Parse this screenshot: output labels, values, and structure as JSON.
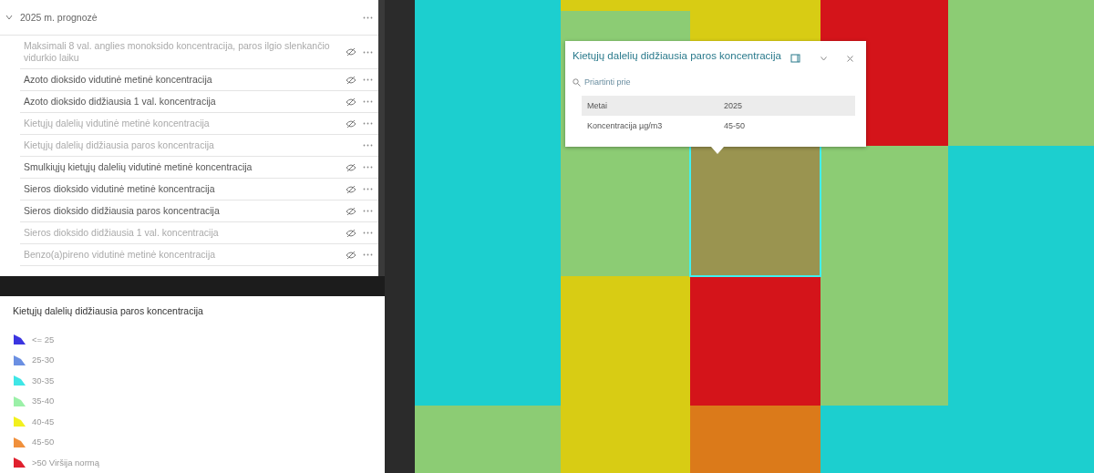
{
  "layer_group": {
    "title": "2025 m. prognozė",
    "expanded": true,
    "layers": [
      {
        "name": "Maksimali 8 val. anglies monoksido koncentracija, paros ilgio slenkančio vidurkio laiku",
        "visible": false,
        "dimmed": true
      },
      {
        "name": "Azoto dioksido vidutinė metinė koncentracija",
        "visible": false,
        "dimmed": false
      },
      {
        "name": "Azoto dioksido didžiausia 1 val. koncentracija",
        "visible": false,
        "dimmed": false
      },
      {
        "name": "Kietųjų dalelių vidutinė metinė koncentracija",
        "visible": false,
        "dimmed": true
      },
      {
        "name": "Kietųjų dalelių didžiausia paros koncentracija",
        "visible": true,
        "dimmed": true
      },
      {
        "name": "Smulkiųjų kietųjų dalelių vidutinė metinė koncentracija",
        "visible": false,
        "dimmed": false
      },
      {
        "name": "Sieros dioksido vidutinė metinė koncentracija",
        "visible": false,
        "dimmed": false
      },
      {
        "name": "Sieros dioksido didžiausia paros koncentracija",
        "visible": false,
        "dimmed": false
      },
      {
        "name": "Sieros dioksido didžiausia 1 val. koncentracija",
        "visible": false,
        "dimmed": true
      },
      {
        "name": "Benzo(a)pireno vidutinė metinė koncentracija",
        "visible": false,
        "dimmed": true
      }
    ]
  },
  "legend": {
    "title": "Kietųjų dalelių didžiausia paros koncentracija",
    "items": [
      {
        "label": "<= 25",
        "color": "#3b35e0"
      },
      {
        "label": "25-30",
        "color": "#6b8fe2"
      },
      {
        "label": "30-35",
        "color": "#3fe6e6"
      },
      {
        "label": "35-40",
        "color": "#9bf0a8"
      },
      {
        "label": "40-45",
        "color": "#f2f01e"
      },
      {
        "label": "45-50",
        "color": "#f0903c"
      },
      {
        "label": ">50 Viršija normą",
        "color": "#e0202e"
      }
    ]
  },
  "popup": {
    "title": "Kietųjų dalelių didžiausia paros koncentracija",
    "zoom_link": "Priartinti prie",
    "fields": [
      {
        "label": "Metai",
        "value": "2025"
      },
      {
        "label": "Koncentracija µg/m3",
        "value": "45-50"
      }
    ]
  }
}
